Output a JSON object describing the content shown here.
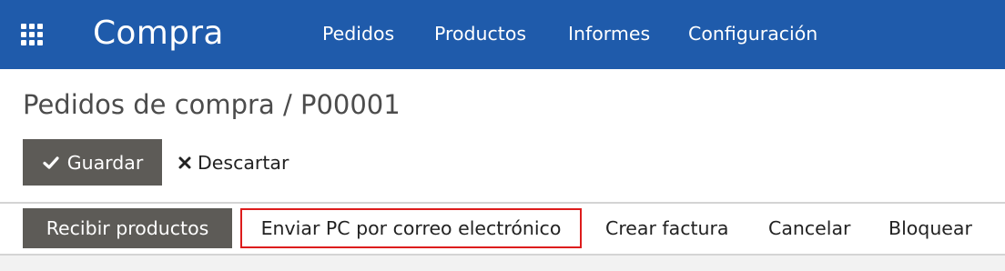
{
  "navbar": {
    "app_title": "Compra",
    "menu": [
      {
        "label": "Pedidos"
      },
      {
        "label": "Productos"
      },
      {
        "label": "Informes"
      },
      {
        "label": "Configuración"
      }
    ],
    "icon": "apps-grid-icon",
    "color": "#1f5bab"
  },
  "breadcrumb": "Pedidos de compra / P00001",
  "actions": {
    "save_label": "Guardar",
    "discard_label": "Descartar"
  },
  "statusbar": {
    "receive_label": "Recibir productos",
    "email_label": "Enviar PC por correo electrónico",
    "invoice_label": "Crear factura",
    "cancel_label": "Cancelar",
    "lock_label": "Bloquear"
  },
  "colors": {
    "primary_button": "#5d5b57",
    "highlight_border": "#dd1c1c"
  }
}
